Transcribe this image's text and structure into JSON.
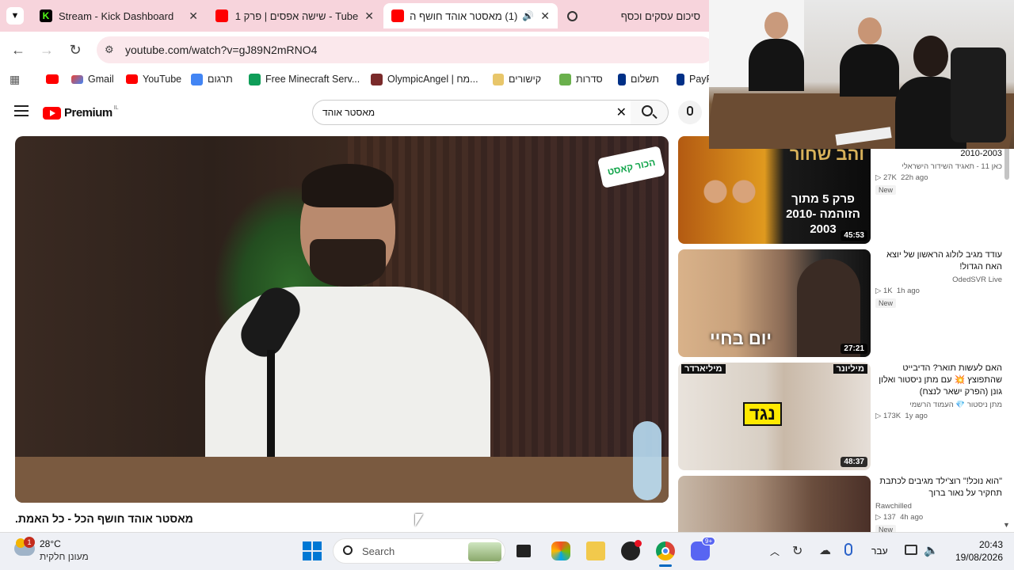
{
  "tabs": [
    {
      "title": "Stream - Kick Dashboard",
      "icon": "kick-icon"
    },
    {
      "title": "Tube - שישה אפסים | פרק 1",
      "icon": "youtube-icon"
    },
    {
      "title": "(1) מאסטר אוהד חושף הכ",
      "icon": "youtube-icon",
      "active": true
    },
    {
      "title": "סיכום עסקים וכסף",
      "icon": "openai-icon"
    }
  ],
  "address": {
    "url": "youtube.com/watch?v=gJ89N2mRNO4"
  },
  "bookmarks": [
    {
      "label": "Gmail"
    },
    {
      "label": "YouTube"
    },
    {
      "label": "תרגום"
    },
    {
      "label": "Free Minecraft Serv..."
    },
    {
      "label": "OlympicAngel | מח..."
    },
    {
      "label": "קישורים"
    },
    {
      "label": "סדרות"
    },
    {
      "label": "תשלום"
    },
    {
      "label": "PayP"
    }
  ],
  "youtube": {
    "logo_text": "Premium",
    "logo_region": "IL",
    "search_value": "מאסטר אוהד"
  },
  "video": {
    "title": "מאסטר אוהד חושף הכל - כל האמת.",
    "podcast_badge": "הכור קאסט"
  },
  "recommendations": [
    {
      "title": "הישראלי | פרק 5 - מתוך הזוהמה 2010-2003",
      "channel": "כאן 11 - תאגיד השידור הישראלי",
      "views": "27K",
      "age": "22h ago",
      "badge": "New",
      "duration": "45:53",
      "thumb_text": "פרק 5 מתוך הזוהמה 2010-2003",
      "thumb_top": "והב שחור"
    },
    {
      "title": "עודד מגיב לולוג הראשון של יוצא האח הגדול!",
      "channel": "OdedSVR Live",
      "views": "1K",
      "age": "1h ago",
      "badge": "New",
      "duration": "27:21",
      "thumb_text": "יום בחיי"
    },
    {
      "title": "האם לעשות תואר? הדיבייט שהתפוצץ 💥 עם מתן ניסטור ואלון גונן (הפרק ישאר לנצח)",
      "channel": "מתן ניסטור 💎 העמוד הרשמי",
      "views": "173K",
      "age": "1y ago",
      "badge": "",
      "duration": "48:37",
      "thumb_text": "נגד",
      "thumb_left": "מיליארדר",
      "thumb_right": "מיליונר"
    },
    {
      "title": "\"הוא נוכל!\" רוצ'ילד מגיבים לכתבת תחקיר על נאור ברוך",
      "channel": "Rawchilled",
      "views": "137",
      "age": "4h ago",
      "badge": "New",
      "duration": ""
    }
  ],
  "taskbar": {
    "weather_temp": "28°C",
    "weather_desc": "מעונן חלקית",
    "weather_badge": "1",
    "search_label": "Search",
    "lang": "עבר",
    "time": "20:43",
    "date": "19/08/2026",
    "discord_badge": "9+"
  },
  "colors": {
    "youtube_red": "#ff0000",
    "tabbar_bg": "#f7d4dc",
    "kick_green": "#53fc18"
  }
}
